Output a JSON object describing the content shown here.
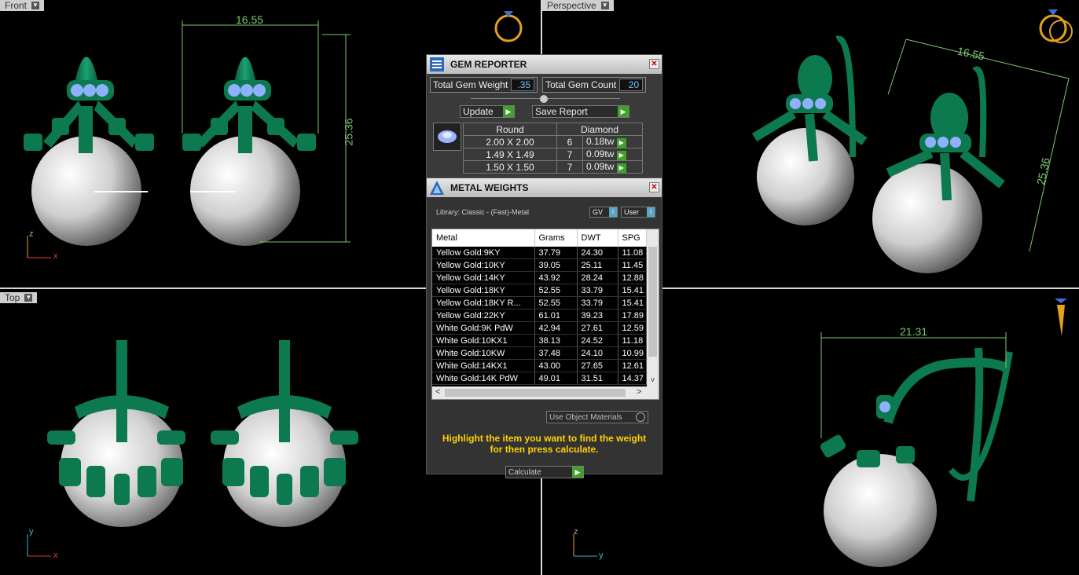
{
  "viewports": {
    "front": {
      "label": "Front",
      "dim_width": "16.55",
      "dim_height": "25.36",
      "axis_x": "x",
      "axis_z": "z"
    },
    "perspective": {
      "label": "Perspective",
      "dim_width": "16.55",
      "dim_height": "25.36"
    },
    "top": {
      "label": "Top",
      "axis_x": "x",
      "axis_y": "y"
    },
    "right": {
      "dim_width": "21.31",
      "axis_z": "z",
      "axis_y": "y"
    }
  },
  "gem_reporter": {
    "title": "GEM REPORTER",
    "total_weight_label": "Total Gem Weight",
    "total_weight_value": ".35",
    "total_count_label": "Total Gem Count",
    "total_count_value": "20",
    "update_label": "Update",
    "save_label": "Save Report",
    "col_shape": "Round",
    "col_material": "Diamond",
    "rows": [
      {
        "size": "2.00 X 2.00",
        "count": "6",
        "tw": "0.18tw"
      },
      {
        "size": "1.49 X 1.49",
        "count": "7",
        "tw": "0.09tw"
      },
      {
        "size": "1.50 X 1.50",
        "count": "7",
        "tw": "0.09tw"
      }
    ]
  },
  "metal_weights": {
    "title": "METAL WEIGHTS",
    "library": "Library: Classic - (Fast)-Metal",
    "gv_label": "GV",
    "user_label": "User",
    "columns": [
      "Metal",
      "Grams",
      "DWT",
      "SPG"
    ],
    "rows": [
      {
        "metal": "Yellow Gold:9KY",
        "grams": "37.79",
        "dwt": "24.30",
        "spg": "11.08"
      },
      {
        "metal": "Yellow Gold:10KY",
        "grams": "39.05",
        "dwt": "25.11",
        "spg": "11.45"
      },
      {
        "metal": "Yellow Gold:14KY",
        "grams": "43.92",
        "dwt": "28.24",
        "spg": "12.88"
      },
      {
        "metal": "Yellow Gold:18KY",
        "grams": "52.55",
        "dwt": "33.79",
        "spg": "15.41"
      },
      {
        "metal": "Yellow Gold:18KY R...",
        "grams": "52.55",
        "dwt": "33.79",
        "spg": "15.41"
      },
      {
        "metal": "Yellow Gold:22KY",
        "grams": "61.01",
        "dwt": "39.23",
        "spg": "17.89"
      },
      {
        "metal": "White Gold:9K PdW",
        "grams": "42.94",
        "dwt": "27.61",
        "spg": "12.59"
      },
      {
        "metal": "White Gold:10KX1",
        "grams": "38.13",
        "dwt": "24.52",
        "spg": "11.18"
      },
      {
        "metal": "White Gold:10KW",
        "grams": "37.48",
        "dwt": "24.10",
        "spg": "10.99"
      },
      {
        "metal": "White Gold:14KX1",
        "grams": "43.00",
        "dwt": "27.65",
        "spg": "12.61"
      },
      {
        "metal": "White Gold:14K PdW",
        "grams": "49.01",
        "dwt": "31.51",
        "spg": "14.37"
      }
    ],
    "use_object_materials": "Use Object Materials",
    "hint": "Highlight the item you want to find the weight for then press calculate.",
    "calculate_label": "Calculate"
  }
}
